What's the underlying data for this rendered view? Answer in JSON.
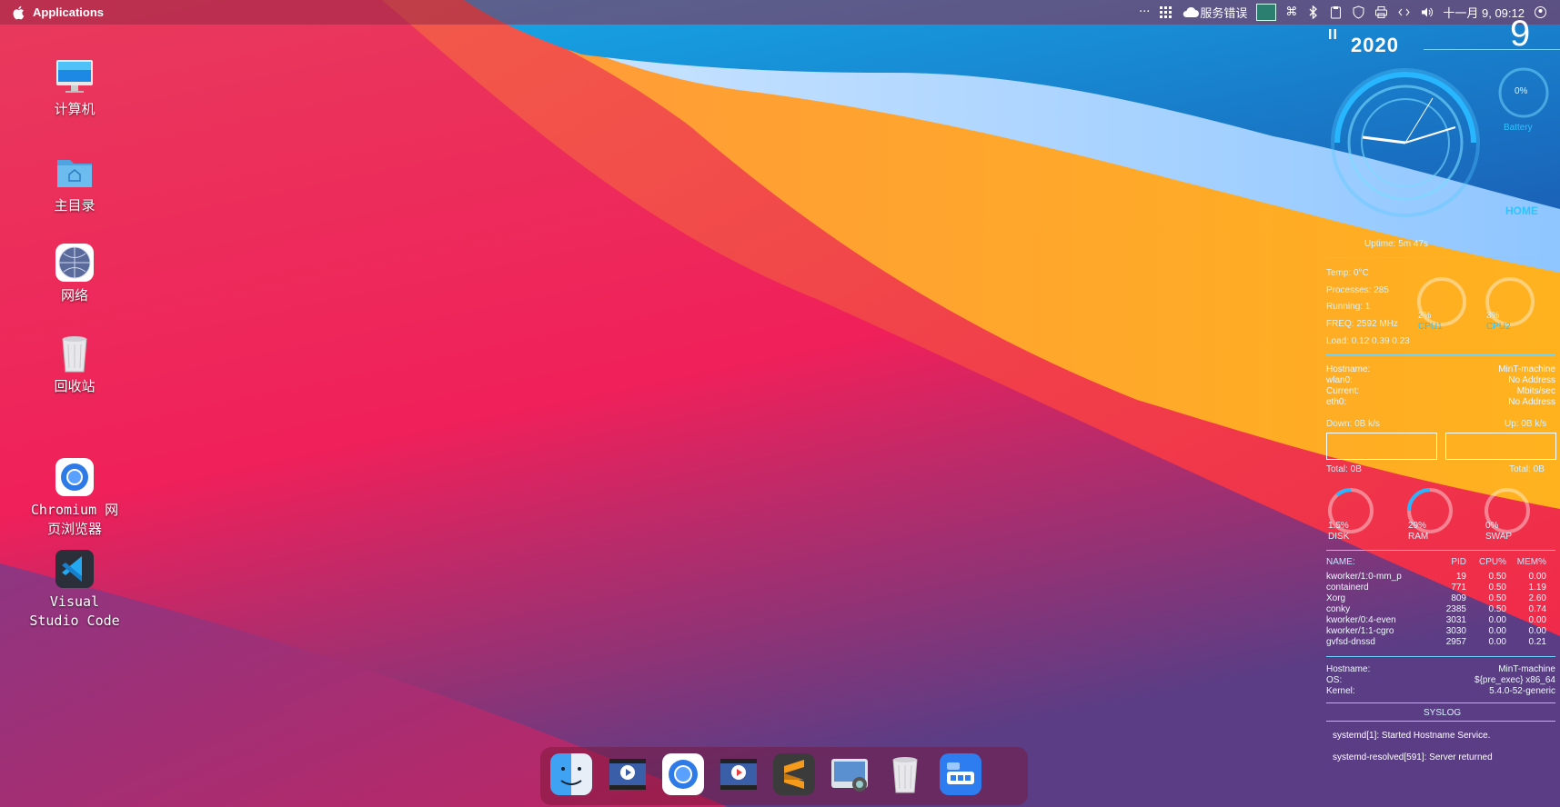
{
  "menubar": {
    "apple_icon": "apple-icon",
    "app_menu": "Applications",
    "tray_dots": "···",
    "service_label": "服务错误",
    "datetime": "十一月 9, 09:12"
  },
  "desktop": {
    "icons": [
      {
        "label": "计算机",
        "icon": "computer-icon"
      },
      {
        "label": "主目录",
        "icon": "home-folder-icon"
      },
      {
        "label": "网络",
        "icon": "network-icon"
      },
      {
        "label": "回收站",
        "icon": "trash-icon"
      },
      {
        "label": "Chromium 网\n页浏览器",
        "icon": "chromium-icon"
      },
      {
        "label": "Visual\nStudio Code",
        "icon": "vscode-icon"
      }
    ]
  },
  "conky": {
    "pause_glyph": "II",
    "year": "2020",
    "day": "9",
    "battery_pct": "0%",
    "battery_label": "Battery",
    "home_label": "HOME",
    "uptime": "Uptime: 5m 47s",
    "temp": "Temp:  0°C",
    "processes": "Processes:  285",
    "running": "Running:    1",
    "freq": "FREQ: 2592 MHz",
    "load": "Load: 0.12 0.39 0.23",
    "cpu1_pct": "2%",
    "cpu1_label": "CPU1",
    "cpu2_pct": "3%",
    "cpu2_label": "CPU2",
    "net": [
      {
        "k": "Hostname:",
        "v": "MinT-machine"
      },
      {
        "k": "wlan0:",
        "v": "No Address"
      },
      {
        "k": "Current:",
        "v": "Mbits/sec"
      },
      {
        "k": "eth0:",
        "v": "No Address"
      }
    ],
    "down": "Down: 0B   k/s",
    "up": "Up: 0B    k/s",
    "total_down": "Total: 0B",
    "total_up": "Total: 0B",
    "disk_pct": "1.5%",
    "disk_label": "DISK",
    "ram_pct": "29%",
    "ram_label": "RAM",
    "swap_pct": "0%",
    "swap_label": "SWAP",
    "proc_headers": {
      "name": "NAME:",
      "pid": "PID",
      "cpu": "CPU%",
      "mem": "MEM%"
    },
    "procs": [
      {
        "name": "kworker/1:0-mm_p",
        "pid": "19",
        "cpu": "0.50",
        "mem": "0.00"
      },
      {
        "name": "containerd",
        "pid": "771",
        "cpu": "0.50",
        "mem": "1.19"
      },
      {
        "name": "Xorg",
        "pid": "809",
        "cpu": "0.50",
        "mem": "2.60"
      },
      {
        "name": "conky",
        "pid": "2385",
        "cpu": "0.50",
        "mem": "0.74"
      },
      {
        "name": "kworker/0:4-even",
        "pid": "3031",
        "cpu": "0.00",
        "mem": "0.00"
      },
      {
        "name": "kworker/1:1-cgro",
        "pid": "3030",
        "cpu": "0.00",
        "mem": "0.00"
      },
      {
        "name": "gvfsd-dnssd",
        "pid": "2957",
        "cpu": "0.00",
        "mem": "0.21"
      }
    ],
    "sys": [
      {
        "k": "Hostname:",
        "v": "MinT-machine"
      },
      {
        "k": "OS:",
        "v": "${pre_exec} x86_64"
      },
      {
        "k": "Kernel:",
        "v": "5.4.0-52-generic"
      }
    ],
    "syslog_title": "SYSLOG",
    "syslog": [
      "systemd[1]: Started Hostname Service.",
      "systemd-resolved[591]: Server returned"
    ]
  },
  "dock": {
    "items": [
      "finder-icon",
      "video-editor-icon",
      "chromium-icon",
      "video-player-icon",
      "sublime-text-icon",
      "screenshot-icon",
      "trash-icon",
      "app-launcher-icon"
    ]
  }
}
